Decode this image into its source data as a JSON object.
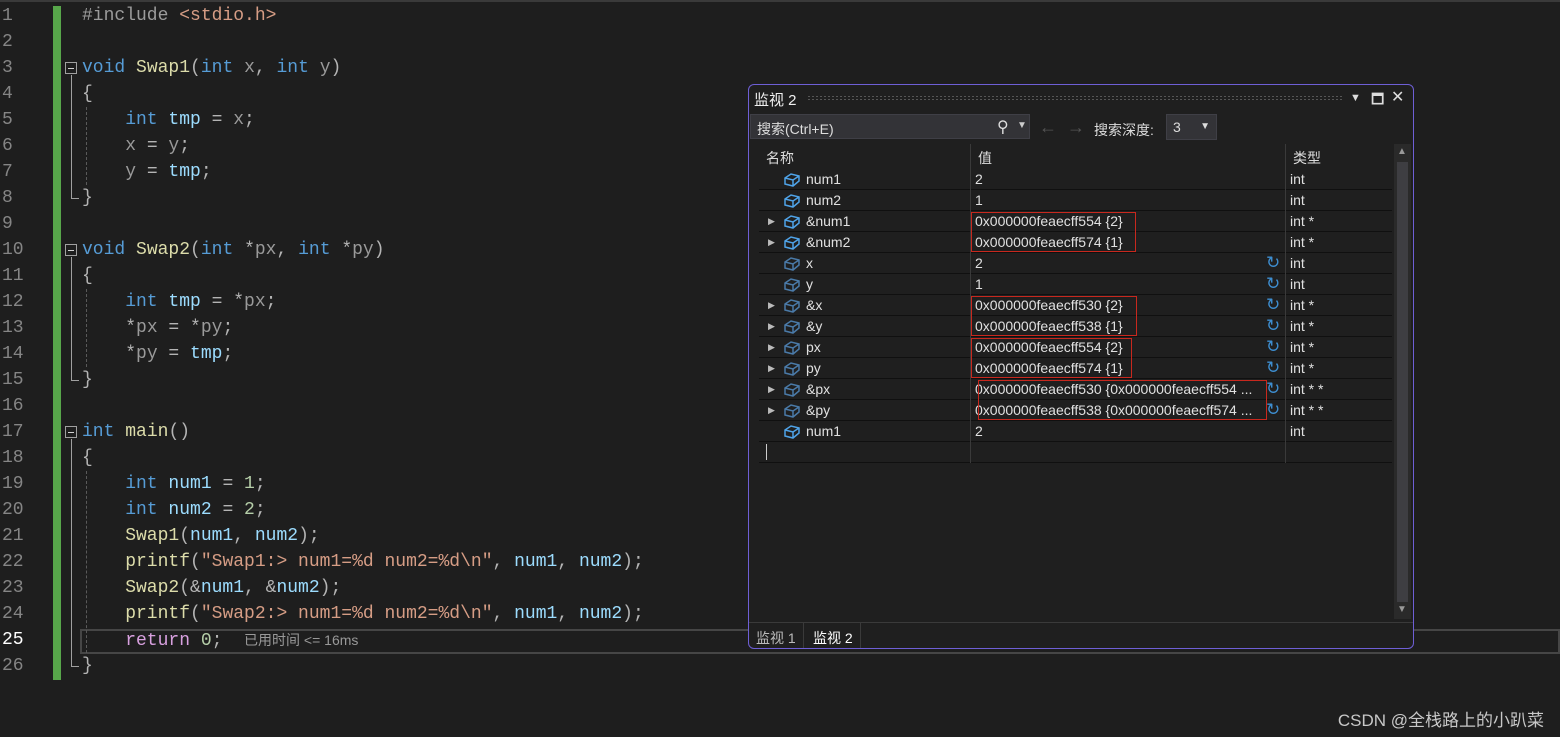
{
  "editor": {
    "current_line": 25,
    "lines": [
      [
        [
          "#include ",
          "pp"
        ],
        [
          "<stdio.h>",
          "str"
        ]
      ],
      [],
      [
        [
          "void ",
          "kw"
        ],
        [
          "Swap1",
          "fn"
        ],
        [
          "(",
          "p"
        ],
        [
          "int ",
          "kw"
        ],
        [
          "x",
          "param"
        ],
        [
          ", ",
          "p"
        ],
        [
          "int ",
          "kw"
        ],
        [
          "y",
          "param"
        ],
        [
          ")",
          "p"
        ]
      ],
      [
        [
          "{",
          "p"
        ]
      ],
      [
        [
          "    int ",
          "kw"
        ],
        [
          "tmp",
          "var"
        ],
        [
          " = ",
          "p"
        ],
        [
          "x",
          "param"
        ],
        [
          ";",
          "p"
        ]
      ],
      [
        [
          "    x",
          "param"
        ],
        [
          " = ",
          "p"
        ],
        [
          "y",
          "param"
        ],
        [
          ";",
          "p"
        ]
      ],
      [
        [
          "    y",
          "param"
        ],
        [
          " = ",
          "p"
        ],
        [
          "tmp",
          "var"
        ],
        [
          ";",
          "p"
        ]
      ],
      [
        [
          "}",
          "p"
        ]
      ],
      [],
      [
        [
          "void ",
          "kw"
        ],
        [
          "Swap2",
          "fn"
        ],
        [
          "(",
          "p"
        ],
        [
          "int ",
          "kw"
        ],
        [
          "*",
          "p"
        ],
        [
          "px",
          "param"
        ],
        [
          ", ",
          "p"
        ],
        [
          "int ",
          "kw"
        ],
        [
          "*",
          "p"
        ],
        [
          "py",
          "param"
        ],
        [
          ")",
          "p"
        ]
      ],
      [
        [
          "{",
          "p"
        ]
      ],
      [
        [
          "    int ",
          "kw"
        ],
        [
          "tmp",
          "var"
        ],
        [
          " = *",
          "p"
        ],
        [
          "px",
          "param"
        ],
        [
          ";",
          "p"
        ]
      ],
      [
        [
          "    *",
          "p"
        ],
        [
          "px",
          "param"
        ],
        [
          " = *",
          "p"
        ],
        [
          "py",
          "param"
        ],
        [
          ";",
          "p"
        ]
      ],
      [
        [
          "    *",
          "p"
        ],
        [
          "py",
          "param"
        ],
        [
          " = ",
          "p"
        ],
        [
          "tmp",
          "var"
        ],
        [
          ";",
          "p"
        ]
      ],
      [
        [
          "}",
          "p"
        ]
      ],
      [],
      [
        [
          "int ",
          "kw"
        ],
        [
          "main",
          "fn"
        ],
        [
          "()",
          "p"
        ]
      ],
      [
        [
          "{",
          "p"
        ]
      ],
      [
        [
          "    int ",
          "kw"
        ],
        [
          "num1",
          "var"
        ],
        [
          " = ",
          "p"
        ],
        [
          "1",
          "num"
        ],
        [
          ";",
          "p"
        ]
      ],
      [
        [
          "    int ",
          "kw"
        ],
        [
          "num2",
          "var"
        ],
        [
          " = ",
          "p"
        ],
        [
          "2",
          "num"
        ],
        [
          ";",
          "p"
        ]
      ],
      [
        [
          "    Swap1",
          "fn"
        ],
        [
          "(",
          "p"
        ],
        [
          "num1",
          "var"
        ],
        [
          ", ",
          "p"
        ],
        [
          "num2",
          "var"
        ],
        [
          ");",
          "p"
        ]
      ],
      [
        [
          "    printf",
          "fn"
        ],
        [
          "(",
          "p"
        ],
        [
          "\"Swap1:> num1=%d num2=%d\\n\"",
          "str"
        ],
        [
          ", ",
          "p"
        ],
        [
          "num1",
          "var"
        ],
        [
          ", ",
          "p"
        ],
        [
          "num2",
          "var"
        ],
        [
          ");",
          "p"
        ]
      ],
      [
        [
          "    Swap2",
          "fn"
        ],
        [
          "(&",
          "p"
        ],
        [
          "num1",
          "var"
        ],
        [
          ", &",
          "p"
        ],
        [
          "num2",
          "var"
        ],
        [
          ");",
          "p"
        ]
      ],
      [
        [
          "    printf",
          "fn"
        ],
        [
          "(",
          "p"
        ],
        [
          "\"Swap2:> num1=%d num2=%d\\n\"",
          "str"
        ],
        [
          ", ",
          "p"
        ],
        [
          "num1",
          "var"
        ],
        [
          ", ",
          "p"
        ],
        [
          "num2",
          "var"
        ],
        [
          ");",
          "p"
        ]
      ],
      [
        [
          "    return ",
          "ctl"
        ],
        [
          "0",
          "num"
        ],
        [
          ";  ",
          "p"
        ],
        [
          "已用时间 <= 16ms",
          "elapsed"
        ]
      ],
      [
        [
          "}",
          "p"
        ]
      ]
    ]
  },
  "watch": {
    "title": "监视 2",
    "search_placeholder": "搜索(Ctrl+E)",
    "depth_label": "搜索深度:",
    "depth_value": "3",
    "columns": [
      "名称",
      "值",
      "类型"
    ],
    "rows": [
      {
        "name": "num1",
        "value": "2",
        "type": "int",
        "expandable": false,
        "refresh": false,
        "stale": false
      },
      {
        "name": "num2",
        "value": "1",
        "type": "int",
        "expandable": false,
        "refresh": false,
        "stale": false
      },
      {
        "name": "&num1",
        "value": "0x000000feaecff554 {2}",
        "type": "int *",
        "expandable": true,
        "refresh": false,
        "stale": false
      },
      {
        "name": "&num2",
        "value": "0x000000feaecff574 {1}",
        "type": "int *",
        "expandable": true,
        "refresh": false,
        "stale": false
      },
      {
        "name": "x",
        "value": "2",
        "type": "int",
        "expandable": false,
        "refresh": true,
        "stale": true
      },
      {
        "name": "y",
        "value": "1",
        "type": "int",
        "expandable": false,
        "refresh": true,
        "stale": true
      },
      {
        "name": "&x",
        "value": "0x000000feaecff530 {2}",
        "type": "int *",
        "expandable": true,
        "refresh": true,
        "stale": true
      },
      {
        "name": "&y",
        "value": "0x000000feaecff538 {1}",
        "type": "int *",
        "expandable": true,
        "refresh": true,
        "stale": true
      },
      {
        "name": "px",
        "value": "0x000000feaecff554 {2}",
        "type": "int *",
        "expandable": true,
        "refresh": true,
        "stale": true
      },
      {
        "name": "py",
        "value": "0x000000feaecff574 {1}",
        "type": "int *",
        "expandable": true,
        "refresh": true,
        "stale": true
      },
      {
        "name": "&px",
        "value": "0x000000feaecff530 {0x000000feaecff554 ...",
        "type": "int * *",
        "expandable": true,
        "refresh": true,
        "stale": true
      },
      {
        "name": "&py",
        "value": "0x000000feaecff538 {0x000000feaecff574 ...",
        "type": "int * *",
        "expandable": true,
        "refresh": true,
        "stale": true
      },
      {
        "name": "num1",
        "value": "2",
        "type": "int",
        "expandable": false,
        "refresh": false,
        "stale": false
      }
    ],
    "tabs": [
      {
        "label": "监视 1",
        "active": false
      },
      {
        "label": "监视 2",
        "active": true
      }
    ]
  },
  "watermark": "CSDN @全栈路上的小趴菜",
  "colors": {
    "accent_border": "#6e5fd6",
    "highlight_box": "#c8281e",
    "change_bar": "#57a64a",
    "keyword": "#569cd6",
    "function": "#dcdcaa",
    "variable": "#9cdcfe",
    "string": "#d69d85"
  }
}
